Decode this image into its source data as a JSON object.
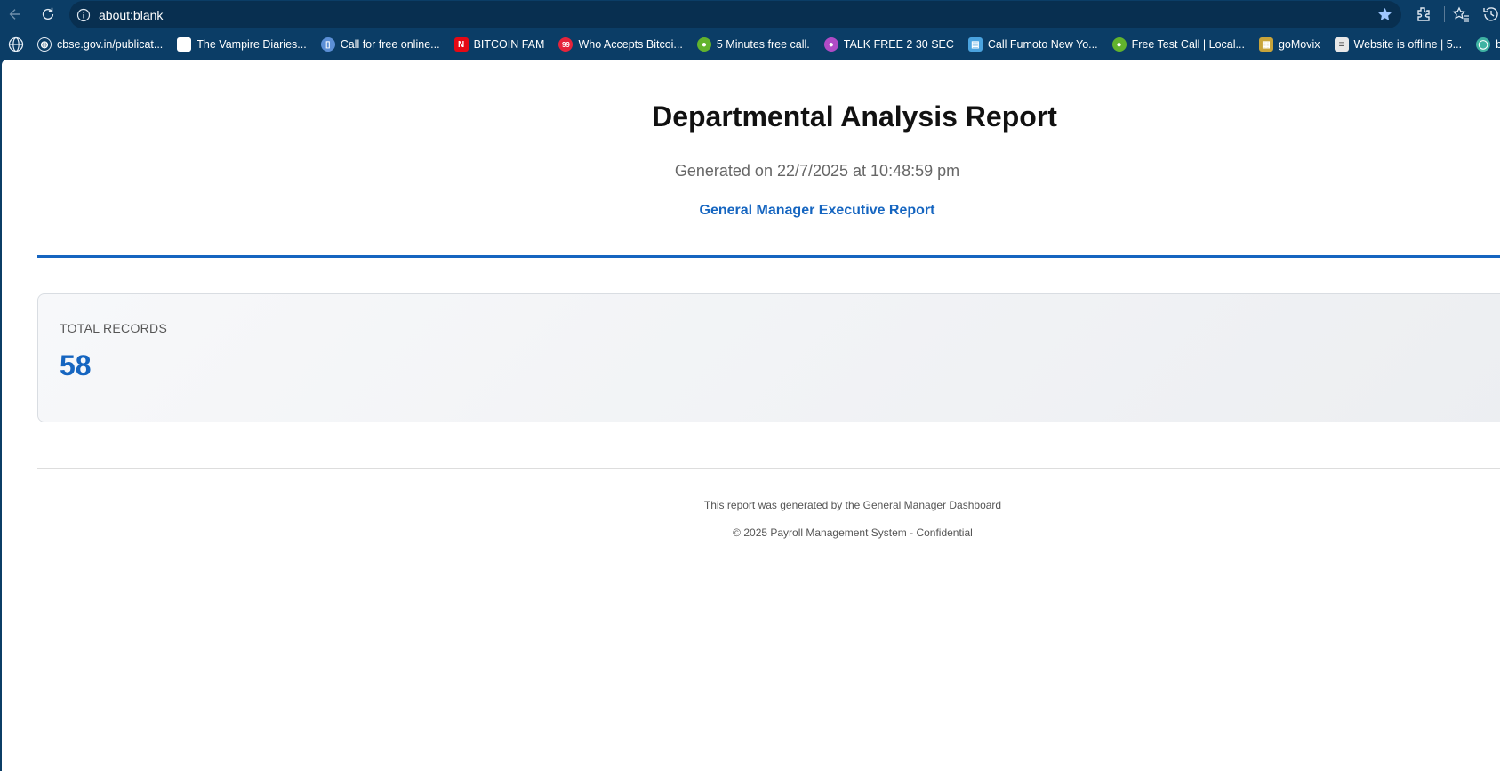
{
  "browser": {
    "address": "about:blank",
    "bookmarks": [
      {
        "label": "cbse.gov.in/publicat...",
        "icon": "globe-icon",
        "color": "#0b3d66"
      },
      {
        "label": "The Vampire Diaries...",
        "icon": "blank-page-icon",
        "color": "#ffffff"
      },
      {
        "label": "Call for free online...",
        "icon": "phone-icon",
        "color": "#5b8fd6"
      },
      {
        "label": "BITCOIN FAM",
        "icon": "netflix-icon",
        "color": "#e50914"
      },
      {
        "label": "Who Accepts Bitcoi...",
        "icon": "99-icon",
        "color": "#e5243b"
      },
      {
        "label": "5 Minutes free call.",
        "icon": "chat-bubble-icon",
        "color": "#62b32d"
      },
      {
        "label": "TALK FREE 2 30 SEC",
        "icon": "talk-bubble-icon",
        "color": "#b04bc6"
      },
      {
        "label": "Call Fumoto New Yo...",
        "icon": "chart-app-icon",
        "color": "#4aa3df"
      },
      {
        "label": "Free Test Call | Local...",
        "icon": "chat-bubble-icon",
        "color": "#62b32d"
      },
      {
        "label": "goMovix",
        "icon": "film-icon",
        "color": "#c8a43a"
      },
      {
        "label": "Website is offline | 5...",
        "icon": "document-icon",
        "color": "#e8e8e8"
      },
      {
        "label": "boring quality",
        "icon": "bulb-icon",
        "color": "#3fb3a3"
      }
    ]
  },
  "report": {
    "title": "Departmental Analysis Report",
    "generated": "Generated on 22/7/2025 at 10:48:59 pm",
    "subtitle": "General Manager Executive Report",
    "stat_label": "TOTAL RECORDS",
    "stat_value": "58",
    "footer_line1": "This report was generated by the General Manager Dashboard",
    "footer_line2": "© 2025 Payroll Management System - Confidential"
  }
}
